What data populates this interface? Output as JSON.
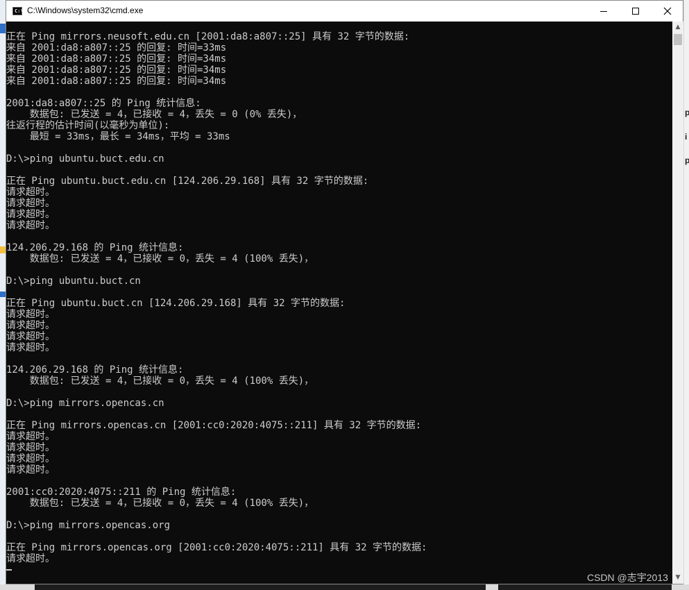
{
  "window": {
    "title": "C:\\Windows\\system32\\cmd.exe",
    "icon_label": "C:\\"
  },
  "console_lines": [
    "正在 Ping mirrors.neusoft.edu.cn [2001:da8:a807::25] 具有 32 字节的数据:",
    "来自 2001:da8:a807::25 的回复: 时间=33ms",
    "来自 2001:da8:a807::25 的回复: 时间=34ms",
    "来自 2001:da8:a807::25 的回复: 时间=34ms",
    "来自 2001:da8:a807::25 的回复: 时间=34ms",
    "",
    "2001:da8:a807::25 的 Ping 统计信息:",
    "    数据包: 已发送 = 4，已接收 = 4，丢失 = 0 (0% 丢失)，",
    "往返行程的估计时间(以毫秒为单位):",
    "    最短 = 33ms，最长 = 34ms，平均 = 33ms",
    "",
    "D:\\>ping ubuntu.buct.edu.cn",
    "",
    "正在 Ping ubuntu.buct.edu.cn [124.206.29.168] 具有 32 字节的数据:",
    "请求超时。",
    "请求超时。",
    "请求超时。",
    "请求超时。",
    "",
    "124.206.29.168 的 Ping 统计信息:",
    "    数据包: 已发送 = 4，已接收 = 0，丢失 = 4 (100% 丢失)，",
    "",
    "D:\\>ping ubuntu.buct.cn",
    "",
    "正在 Ping ubuntu.buct.cn [124.206.29.168] 具有 32 字节的数据:",
    "请求超时。",
    "请求超时。",
    "请求超时。",
    "请求超时。",
    "",
    "124.206.29.168 的 Ping 统计信息:",
    "    数据包: 已发送 = 4，已接收 = 0，丢失 = 4 (100% 丢失)，",
    "",
    "D:\\>ping mirrors.opencas.cn",
    "",
    "正在 Ping mirrors.opencas.cn [2001:cc0:2020:4075::211] 具有 32 字节的数据:",
    "请求超时。",
    "请求超时。",
    "请求超时。",
    "请求超时。",
    "",
    "2001:cc0:2020:4075::211 的 Ping 统计信息:",
    "    数据包: 已发送 = 4，已接收 = 0，丢失 = 4 (100% 丢失)，",
    "",
    "D:\\>ping mirrors.opencas.org",
    "",
    "正在 Ping mirrors.opencas.org [2001:cc0:2020:4075::211] 具有 32 字节的数据:",
    "请求超时。"
  ],
  "watermark": "CSDN @志宇2013",
  "colors": {
    "console_bg": "#0c0c0c",
    "console_text": "#cccccc",
    "titlebar_bg": "#ffffff"
  },
  "icons": {
    "minimize": "minimize-icon",
    "maximize": "maximize-icon",
    "close": "close-icon",
    "scroll_up": "scroll-up-arrow-icon",
    "scroll_down": "scroll-down-arrow-icon"
  }
}
